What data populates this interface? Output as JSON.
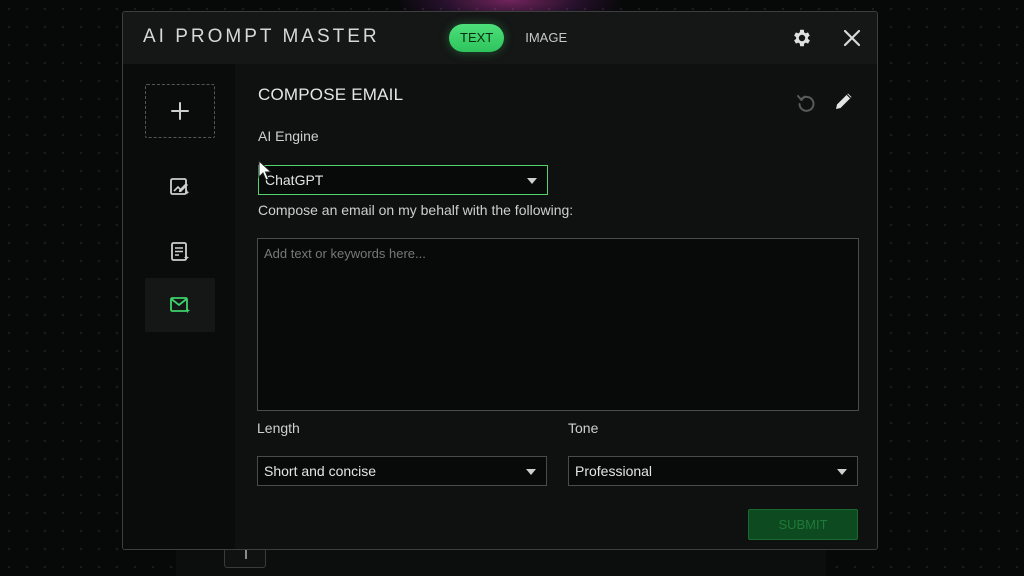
{
  "app": {
    "title": "AI PROMPT MASTER"
  },
  "header": {
    "tabs": [
      {
        "label": "TEXT",
        "active": true
      },
      {
        "label": "IMAGE",
        "active": false
      }
    ],
    "icons": {
      "settings": "gear-icon",
      "close": "close-icon"
    }
  },
  "sidebar": {
    "items": [
      {
        "name": "new-prompt",
        "icon": "plus-icon"
      },
      {
        "name": "image-prompt",
        "icon": "image-edit-icon"
      },
      {
        "name": "text-prompt",
        "icon": "document-edit-icon"
      },
      {
        "name": "compose-email",
        "icon": "mail-edit-icon",
        "active": true
      }
    ]
  },
  "form": {
    "title": "COMPOSE EMAIL",
    "engine": {
      "label": "AI Engine",
      "value": "ChatGPT"
    },
    "compose": {
      "label": "Compose an email on my behalf with the following:",
      "placeholder": "Add text or keywords here...",
      "value": ""
    },
    "length": {
      "label": "Length",
      "value": "Short and concise"
    },
    "tone": {
      "label": "Tone",
      "value": "Professional"
    },
    "submit_label": "SUBMIT"
  },
  "colors": {
    "accent": "#3ed26a",
    "panel": "#0f1010",
    "submit_disabled": "#0d4a1f"
  }
}
